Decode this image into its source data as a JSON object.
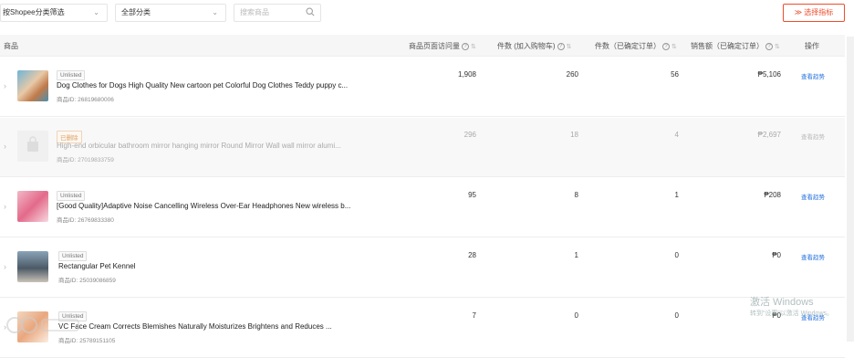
{
  "filters": {
    "shopee_category": "按Shopee分类筛选",
    "all_category": "全部分类",
    "search_placeholder": "搜索商品",
    "metrics_button": "选择指标"
  },
  "table": {
    "headers": {
      "product": "商品",
      "page_views": "商品页面访问量",
      "add_to_cart": "件数 (加入购物车)",
      "confirmed_units": "件数（已确定订单）",
      "sales": "销售额（已确定订单）",
      "actions": "操作"
    },
    "rows": [
      {
        "status": "Unlisted",
        "name": "Dog Clothes for Dogs High Quality New cartoon pet Colorful Dog Clothes Teddy puppy c...",
        "id": "商品ID: 26819680006",
        "views": "1,908",
        "cart": "260",
        "units": "56",
        "sales": "₱5,106",
        "action": "查看趋势"
      },
      {
        "status": "已删除",
        "name": "High-end orbicular bathroom mirror hanging mirror Round Mirror Wall wall mirror alumi...",
        "id": "商品ID: 27019833759",
        "views": "296",
        "cart": "18",
        "units": "4",
        "sales": "₱2,697",
        "action": "查看趋势"
      },
      {
        "status": "Unlisted",
        "name": "[Good Quality]Adaptive Noise Cancelling Wireless Over-Ear Headphones New wireless b...",
        "id": "商品ID: 26769833380",
        "views": "95",
        "cart": "8",
        "units": "1",
        "sales": "₱208",
        "action": "查看趋势"
      },
      {
        "status": "Unlisted",
        "name": "Rectangular Pet Kennel",
        "id": "商品ID: 25039086859",
        "views": "28",
        "cart": "1",
        "units": "0",
        "sales": "₱0",
        "action": "查看趋势"
      },
      {
        "status": "Unlisted",
        "name": "VC Face Cream Corrects Blemishes Naturally Moisturizes Brightens and Reduces ...",
        "id": "商品ID: 25789151105",
        "views": "7",
        "cart": "0",
        "units": "0",
        "sales": "₱0",
        "action": "查看趋势"
      }
    ]
  },
  "watermark": {
    "line1": "激活 Windows",
    "line2": "转到“设置”以激活 Windows。"
  },
  "colors": {
    "accent": "#ee4d2d",
    "link": "#2673dd"
  }
}
